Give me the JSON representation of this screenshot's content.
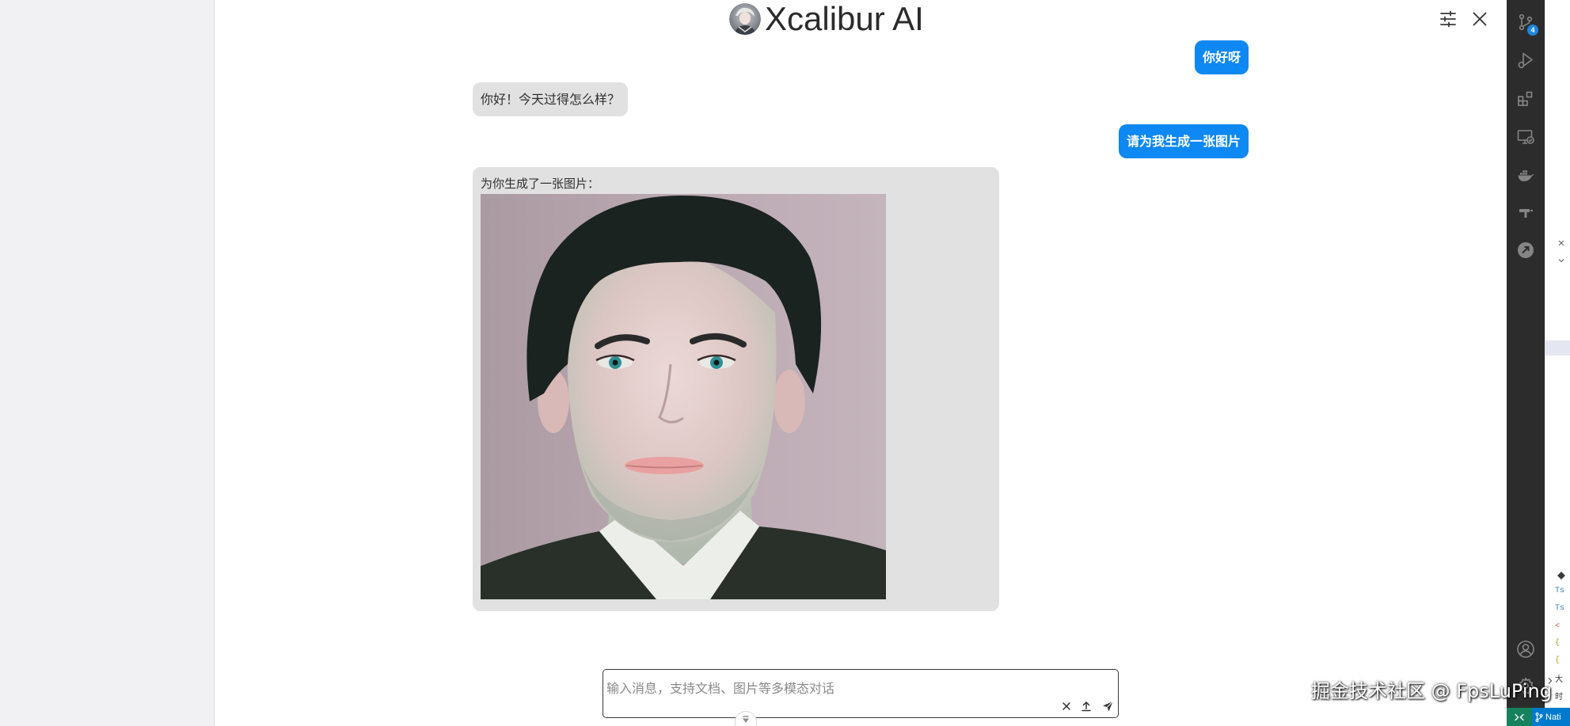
{
  "app": {
    "title": "Xcalibur AI",
    "avatar_icon": "bot-avatar-icon",
    "header_icons": [
      "sliders-icon",
      "close-icon"
    ]
  },
  "messages": [
    {
      "role": "user",
      "text": "你好呀"
    },
    {
      "role": "assistant",
      "text": "你好！今天过得怎么样？"
    },
    {
      "role": "user",
      "text": "请为我生成一张图片"
    },
    {
      "role": "assistant",
      "text": "为你生成了一张图片：",
      "image_icon": "generated-portrait-image"
    }
  ],
  "composer": {
    "placeholder": "输入消息，支持文档、图片等多模态对话",
    "value": "",
    "icons": [
      "clear-icon",
      "upload-icon",
      "send-icon"
    ]
  },
  "scroll_button_icon": "chevron-down-icon",
  "watermark": "掘金技术社区 @ FpsLuPing",
  "vscode": {
    "activity_bar_icons": [
      "source-control-icon",
      "run-debug-icon",
      "extensions-icon",
      "remote-explorer-icon",
      "docker-icon",
      "pipeline-icon",
      "bookmark-circle-icon",
      "account-icon",
      "gear-icon"
    ],
    "source_control_badge": "4",
    "editor_fragments": [
      "Ts",
      "Ts",
      "<",
      "{",
      "{"
    ],
    "outline_items": [
      "大",
      "时"
    ],
    "status_bar": {
      "remote_icon": "remote-icon",
      "branch_icon": "git-branch-icon",
      "branch_text": "Nati"
    }
  },
  "colors": {
    "user_bubble": "#0e88f2",
    "assistant_bubble": "#e1e1e1",
    "left_pane": "#f1f1f3",
    "activity_bar": "#2c2c2c",
    "status_remote": "#16825d",
    "status_blue": "#007acc"
  }
}
